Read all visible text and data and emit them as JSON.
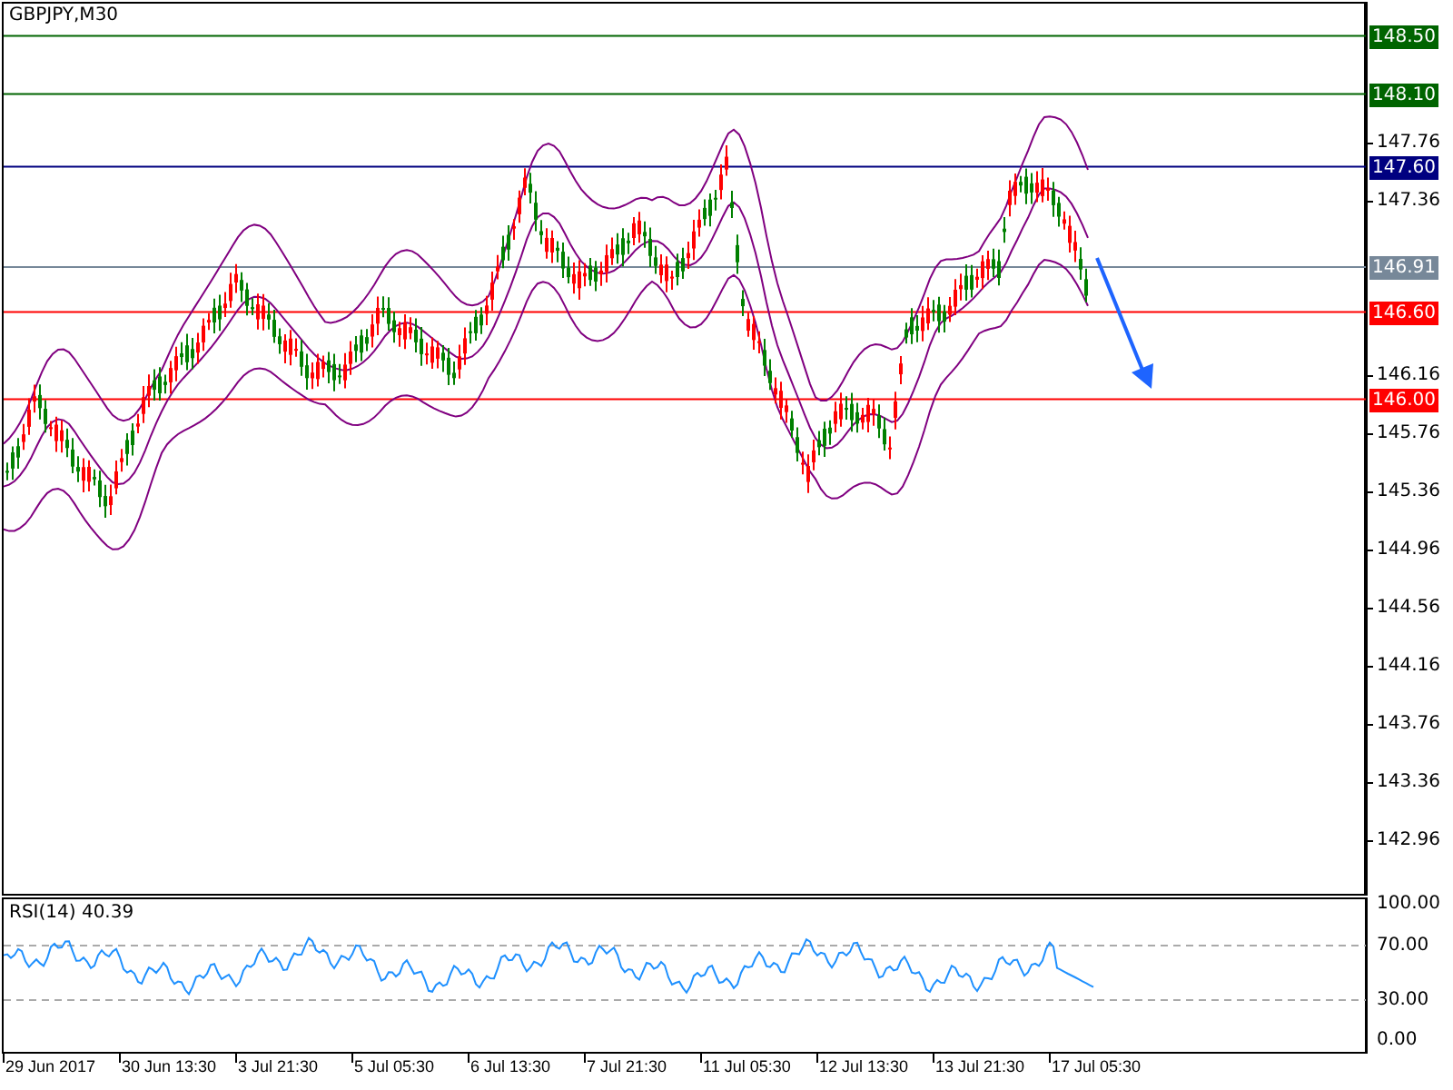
{
  "chart": {
    "title": "GBPJPY,M30",
    "price_ticks": [
      "147.76",
      "147.36",
      "146.16",
      "145.76",
      "145.36",
      "144.96",
      "144.56",
      "144.16",
      "143.76",
      "143.36",
      "142.96"
    ],
    "levels": [
      {
        "label": "148.50",
        "color": "#006400"
      },
      {
        "label": "148.10",
        "color": "#006400"
      },
      {
        "label": "147.60",
        "color": "#000080"
      },
      {
        "label": "146.91",
        "color": "#778899"
      },
      {
        "label": "146.60",
        "color": "#ff0000"
      },
      {
        "label": "146.00",
        "color": "#ff0000"
      }
    ]
  },
  "rsi": {
    "label": "RSI(14) 40.39",
    "ticks": [
      "100.00",
      "70.00",
      "30.00",
      "0.00"
    ]
  },
  "time_axis": [
    "29 Jun 2017",
    "30 Jun 13:30",
    "3 Jul 21:30",
    "5 Jul 05:30",
    "6 Jul 13:30",
    "7 Jul 21:30",
    "11 Jul 05:30",
    "12 Jul 13:30",
    "13 Jul 21:30",
    "17 Jul 05:30"
  ]
}
